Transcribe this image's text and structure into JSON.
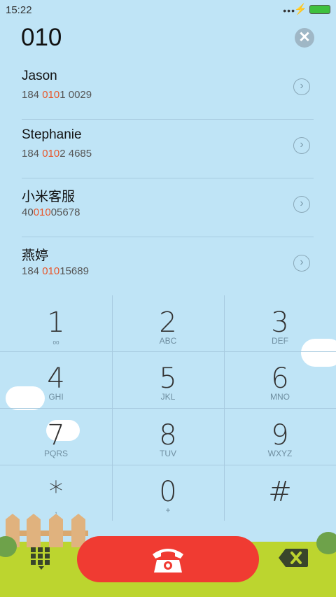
{
  "status": {
    "time": "15:22",
    "signal": "•••",
    "charging": "⚡"
  },
  "dialer": {
    "input": "010",
    "clear": "✕"
  },
  "contacts": [
    {
      "name": "Jason",
      "pre": "184 ",
      "hl": "010",
      "post": "1 0029"
    },
    {
      "name": "Stephanie",
      "pre": "184 ",
      "hl": "010",
      "post": "2 4685"
    },
    {
      "name": "小米客服",
      "pre": "40",
      "hl": "010",
      "post": "05678"
    },
    {
      "name": "燕婷",
      "pre": "184 ",
      "hl": "010",
      "post": "15689"
    }
  ],
  "chevron": "›",
  "keys": [
    {
      "digit": "1",
      "letters": "ₒₒ"
    },
    {
      "digit": "2",
      "letters": "ABC"
    },
    {
      "digit": "3",
      "letters": "DEF"
    },
    {
      "digit": "4",
      "letters": "GHI"
    },
    {
      "digit": "5",
      "letters": "JKL"
    },
    {
      "digit": "6",
      "letters": "MNO"
    },
    {
      "digit": "7",
      "letters": "PQRS"
    },
    {
      "digit": "8",
      "letters": "TUV"
    },
    {
      "digit": "9",
      "letters": "WXYZ"
    },
    {
      "digit": "*",
      "letters": ","
    },
    {
      "digit": "0",
      "letters": "+"
    },
    {
      "digit": "#",
      "letters": ""
    }
  ],
  "colors": {
    "background": "#bfe4f6",
    "highlight": "#e8562a",
    "call": "#f03b32",
    "grass": "#bcd52f"
  },
  "icons": {
    "call": "phone-icon",
    "delete": "backspace-icon",
    "toggle": "dialpad-icon"
  }
}
